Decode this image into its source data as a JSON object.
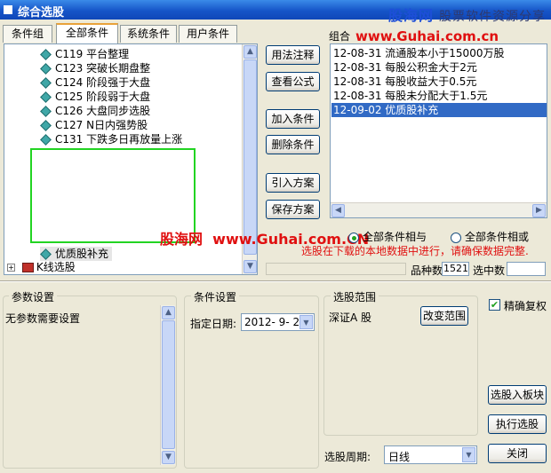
{
  "window": {
    "title": "综合选股"
  },
  "watermark": {
    "logo": "股海网",
    "slogan": "股票软件资源分享",
    "url": "www.Guhai.com.cn",
    "mid_logo": "股海网",
    "mid_url": "www.Guhai.com.CN"
  },
  "tabs": [
    {
      "label": "条件组"
    },
    {
      "label": "全部条件"
    },
    {
      "label": "系统条件"
    },
    {
      "label": "用户条件"
    }
  ],
  "tree": {
    "items": [
      {
        "code": "C119",
        "label": "平台整理"
      },
      {
        "code": "C123",
        "label": "突破长期盘整"
      },
      {
        "code": "C124",
        "label": "阶段强于大盘"
      },
      {
        "code": "C125",
        "label": "阶段弱于大盘"
      },
      {
        "code": "C126",
        "label": "大盘同步选股"
      },
      {
        "code": "C127",
        "label": "N日内强势股"
      },
      {
        "code": "C131",
        "label": "下跌多日再放量上涨"
      }
    ],
    "custom_item": "优质股补充",
    "folder": "K线选股"
  },
  "actions": {
    "usage": "用法注释",
    "formula": "查看公式",
    "add": "加入条件",
    "delete": "删除条件",
    "import": "引入方案",
    "save": "保存方案"
  },
  "combo": {
    "label": "组合",
    "items": [
      "12-08-31 流通股本小于15000万股",
      "12-08-31 每股公积金大于2元",
      "12-08-31 每股收益大于0.5元",
      "12-08-31 每股未分配大于1.5元",
      "12-09-02 优质股补充"
    ],
    "selected_index": 4,
    "radio_and": "全部条件相与",
    "radio_or": "全部条件相或",
    "notice": "选股在下载的本地数据中进行，请确保数据完整.",
    "count_label": "品种数",
    "count_value": "1521",
    "selected_label": "选中数",
    "selected_value": ""
  },
  "params": {
    "title": "参数设置",
    "text": "无参数需要设置"
  },
  "cond": {
    "title": "条件设置",
    "date_label": "指定日期:",
    "date_value": "2012- 9- 2"
  },
  "range": {
    "title": "选股范围",
    "value": "深证A 股",
    "change_button": "改变范围"
  },
  "period": {
    "label": "选股周期:",
    "value": "日线"
  },
  "right": {
    "exact_label": "精确复权",
    "exact_checked": true,
    "to_board": "选股入板块",
    "execute": "执行选股",
    "close": "关闭"
  }
}
